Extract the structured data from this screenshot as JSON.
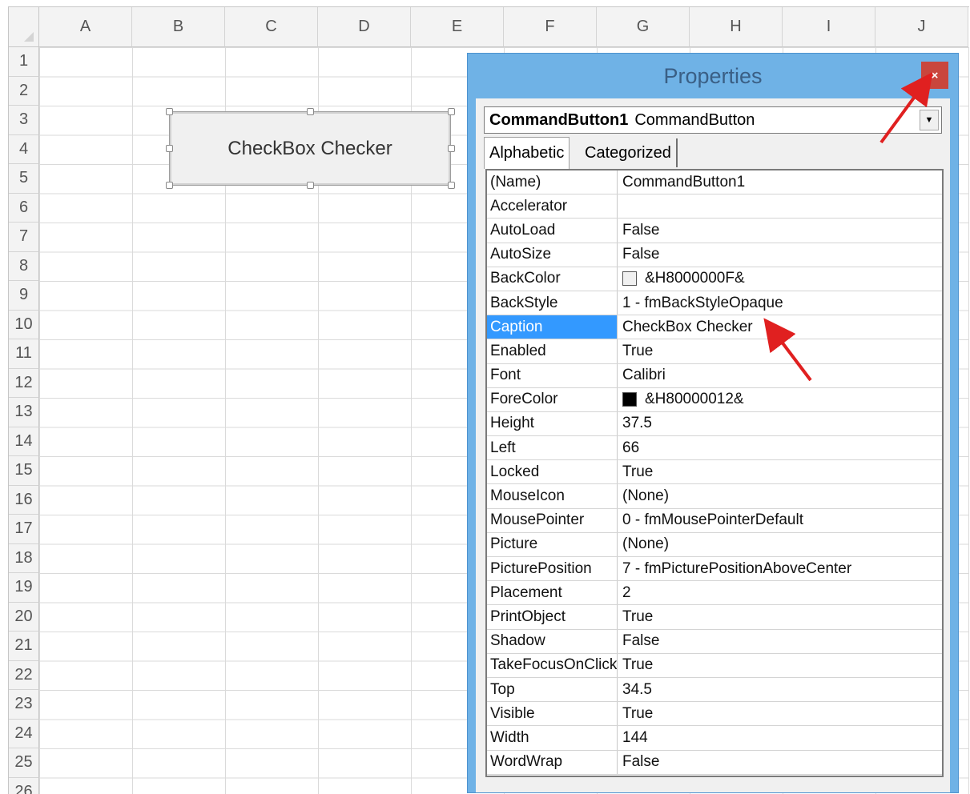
{
  "sheet": {
    "columns": [
      "A",
      "B",
      "C",
      "D",
      "E",
      "F",
      "G",
      "H",
      "I",
      "J"
    ],
    "rows": [
      "1",
      "2",
      "3",
      "4",
      "5",
      "6",
      "7",
      "8",
      "9",
      "10",
      "11",
      "12",
      "13",
      "14",
      "15",
      "16",
      "17",
      "18",
      "19",
      "20",
      "21",
      "22",
      "23",
      "24",
      "25",
      "26"
    ]
  },
  "button": {
    "caption": "CheckBox Checker"
  },
  "properties": {
    "title": "Properties",
    "close_glyph": "×",
    "object_name": "CommandButton1",
    "object_type": "CommandButton",
    "tabs": [
      "Alphabetic",
      "Categorized"
    ],
    "selected_property": "Caption",
    "items": [
      {
        "name": "(Name)",
        "value": "CommandButton1"
      },
      {
        "name": "Accelerator",
        "value": ""
      },
      {
        "name": "AutoLoad",
        "value": "False"
      },
      {
        "name": "AutoSize",
        "value": "False"
      },
      {
        "name": "BackColor",
        "value": "&H8000000F&",
        "swatch": "#f0f0f0"
      },
      {
        "name": "BackStyle",
        "value": "1 - fmBackStyleOpaque"
      },
      {
        "name": "Caption",
        "value": "CheckBox Checker"
      },
      {
        "name": "Enabled",
        "value": "True"
      },
      {
        "name": "Font",
        "value": "Calibri"
      },
      {
        "name": "ForeColor",
        "value": "&H80000012&",
        "swatch": "#000000"
      },
      {
        "name": "Height",
        "value": "37.5"
      },
      {
        "name": "Left",
        "value": "66"
      },
      {
        "name": "Locked",
        "value": "True"
      },
      {
        "name": "MouseIcon",
        "value": "(None)"
      },
      {
        "name": "MousePointer",
        "value": "0 - fmMousePointerDefault"
      },
      {
        "name": "Picture",
        "value": "(None)"
      },
      {
        "name": "PicturePosition",
        "value": "7 - fmPicturePositionAboveCenter"
      },
      {
        "name": "Placement",
        "value": "2"
      },
      {
        "name": "PrintObject",
        "value": "True"
      },
      {
        "name": "Shadow",
        "value": "False"
      },
      {
        "name": "TakeFocusOnClick",
        "value": "True"
      },
      {
        "name": "Top",
        "value": "34.5"
      },
      {
        "name": "Visible",
        "value": "True"
      },
      {
        "name": "Width",
        "value": "144"
      },
      {
        "name": "WordWrap",
        "value": "False"
      }
    ]
  },
  "colors": {
    "window_frame": "#6fb2e6",
    "selection": "#3399ff",
    "annotation_arrow": "#e02020",
    "close_button": "#c9463d"
  }
}
